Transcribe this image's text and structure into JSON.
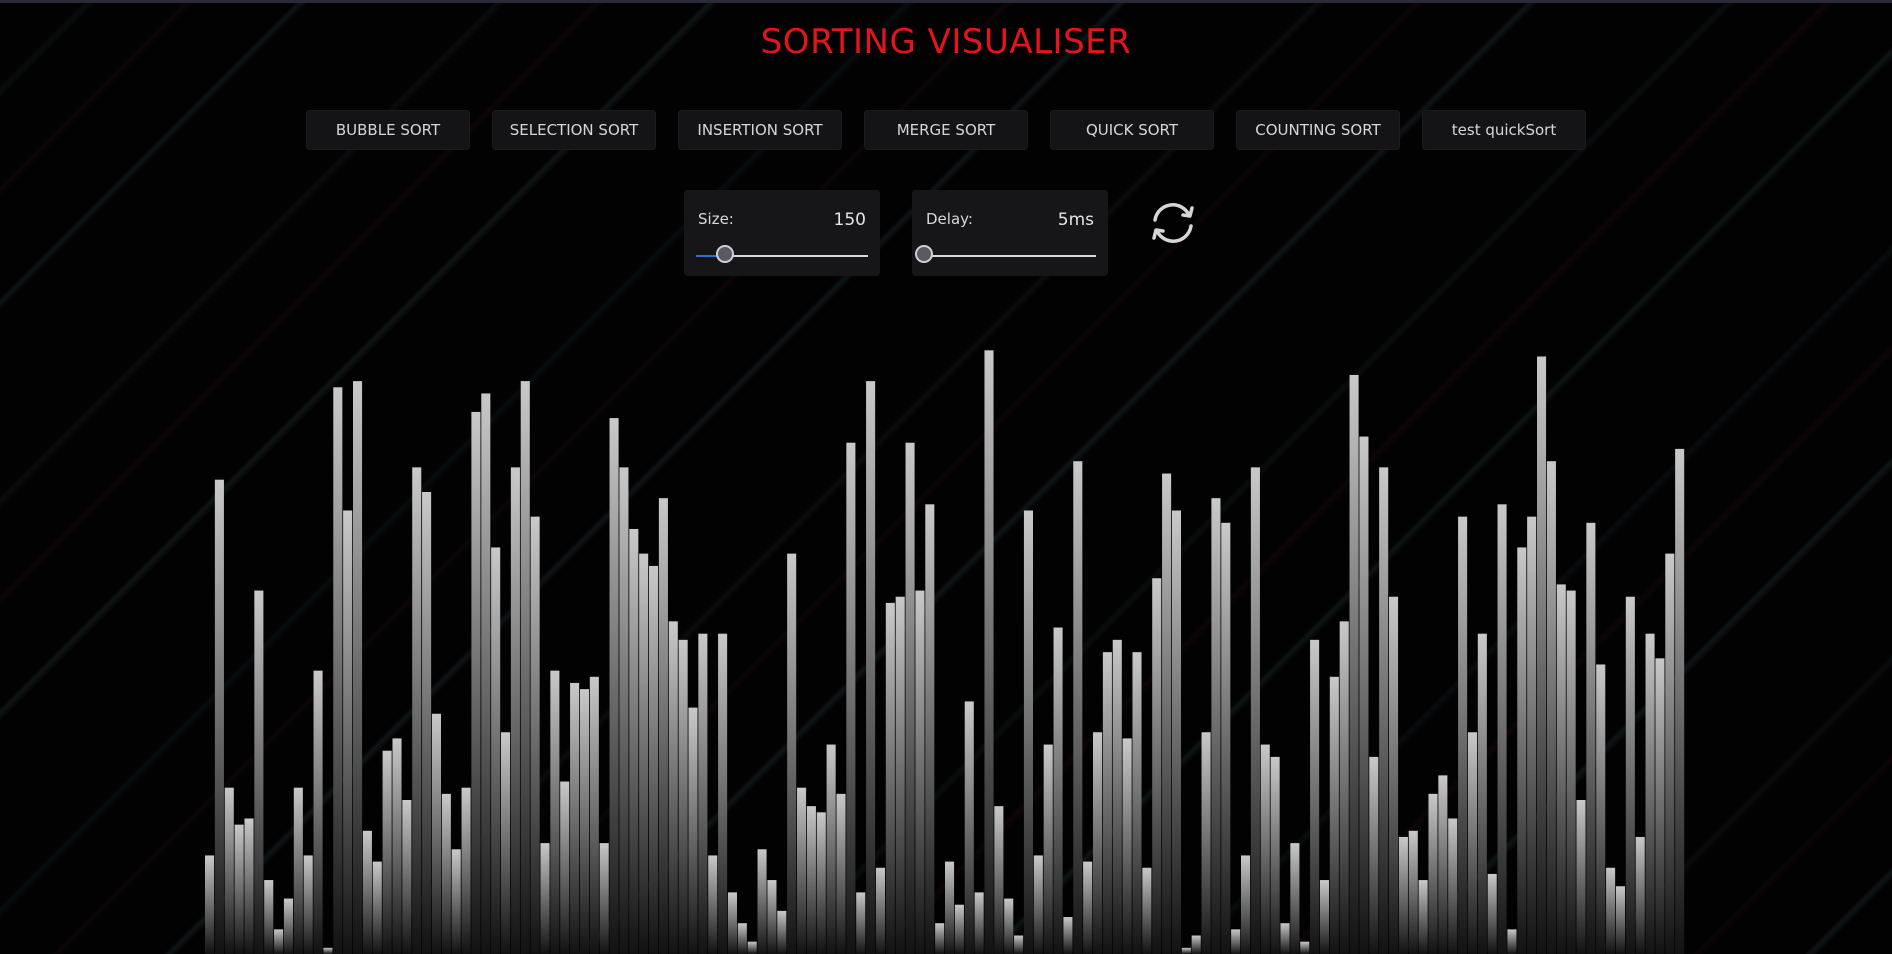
{
  "header": {
    "title": "SORTING VISUALISER"
  },
  "algorithms": [
    {
      "label": "BUBBLE SORT"
    },
    {
      "label": "SELECTION SORT"
    },
    {
      "label": "INSERTION SORT"
    },
    {
      "label": "MERGE SORT"
    },
    {
      "label": "QUICK SORT"
    },
    {
      "label": "COUNTING SORT"
    },
    {
      "label": "test quickSort"
    }
  ],
  "controls": {
    "size": {
      "label": "Size:",
      "value": "150",
      "fraction": 0.17
    },
    "delay": {
      "label": "Delay:",
      "value": "5ms",
      "fraction": 0.0
    },
    "reset_icon": "refresh-icon"
  },
  "colors": {
    "title": "#e3141b",
    "bar_top": "#c9c9c9",
    "bar_bottom": "#121212",
    "slider_fill": "#2e6fd6"
  },
  "chart_data": {
    "type": "bar",
    "values": [
      16,
      77,
      27,
      21,
      22,
      59,
      12,
      4,
      9,
      27,
      16,
      46,
      1,
      92,
      72,
      93,
      20,
      15,
      33,
      35,
      25,
      79,
      75,
      39,
      26,
      17,
      27,
      88,
      91,
      66,
      36,
      79,
      93,
      71,
      18,
      46,
      28,
      44,
      43,
      45,
      18,
      87,
      79,
      69,
      65,
      63,
      74,
      54,
      51,
      40,
      52,
      16,
      52,
      10,
      5,
      2,
      17,
      12,
      7,
      65,
      27,
      24,
      23,
      34,
      26,
      83,
      10,
      93,
      14,
      57,
      58,
      83,
      59,
      73,
      5,
      15,
      8,
      41,
      10,
      98,
      24,
      9,
      3,
      72,
      16,
      34,
      53,
      6,
      80,
      15,
      36,
      49,
      51,
      35,
      49,
      14,
      61,
      78,
      72,
      1,
      3,
      36,
      74,
      70,
      4,
      16,
      79,
      34,
      32,
      5,
      18,
      2,
      51,
      12,
      45,
      54,
      94,
      84,
      32,
      79,
      58,
      19,
      20,
      12,
      26,
      29,
      22,
      71,
      36,
      52,
      13,
      73,
      4,
      66,
      71,
      97,
      80,
      60,
      59,
      25,
      70,
      47,
      14,
      11,
      58,
      19,
      52,
      48,
      65,
      82
    ]
  }
}
